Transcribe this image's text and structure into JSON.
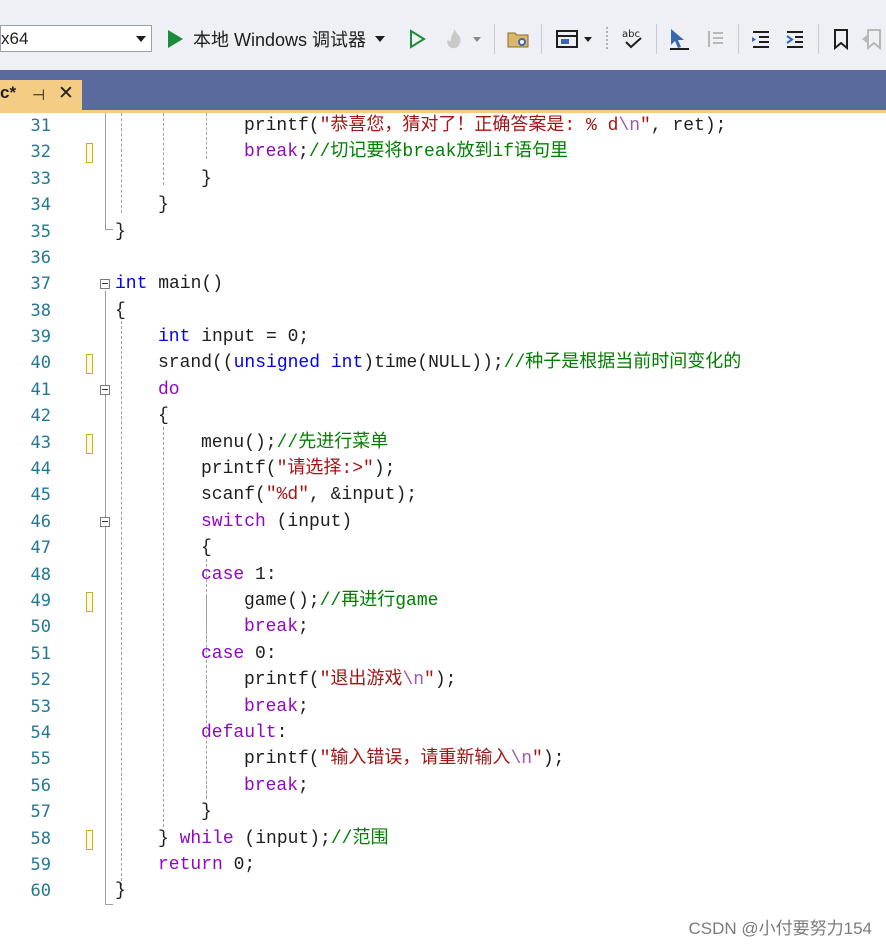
{
  "toolbar": {
    "platform": "x64",
    "debug_target": "本地 Windows 调试器"
  },
  "tab": {
    "title": "c*",
    "pin_glyph": "⊣",
    "close_glyph": "✕"
  },
  "editor": {
    "lines": [
      {
        "n": "31"
      },
      {
        "n": "32"
      },
      {
        "n": "33"
      },
      {
        "n": "34"
      },
      {
        "n": "35"
      },
      {
        "n": "36"
      },
      {
        "n": "37"
      },
      {
        "n": "38"
      },
      {
        "n": "39"
      },
      {
        "n": "40"
      },
      {
        "n": "41"
      },
      {
        "n": "42"
      },
      {
        "n": "43"
      },
      {
        "n": "44"
      },
      {
        "n": "45"
      },
      {
        "n": "46"
      },
      {
        "n": "47"
      },
      {
        "n": "48"
      },
      {
        "n": "49"
      },
      {
        "n": "50"
      },
      {
        "n": "51"
      },
      {
        "n": "52"
      },
      {
        "n": "53"
      },
      {
        "n": "54"
      },
      {
        "n": "55"
      },
      {
        "n": "56"
      },
      {
        "n": "57"
      },
      {
        "n": "58"
      },
      {
        "n": "59"
      },
      {
        "n": "60"
      }
    ],
    "code": {
      "l31": [
        "printf(",
        "\"恭喜您，猜对了！正确答案是: % d",
        "\\n",
        "\"",
        ", ret);"
      ],
      "l32": [
        "break",
        ";",
        "//切记要将break放到if语句里"
      ],
      "l33": [
        "}"
      ],
      "l34": [
        "}"
      ],
      "l35": [
        "}"
      ],
      "l37": [
        "int",
        " main()"
      ],
      "l38": [
        "{"
      ],
      "l39": [
        "int",
        " input = 0;"
      ],
      "l40": [
        "srand((",
        "unsigned",
        " ",
        "int",
        ")time(NULL));",
        "//种子是根据当前时间变化的"
      ],
      "l41": [
        "do"
      ],
      "l42": [
        "{"
      ],
      "l43": [
        "menu();",
        "//先进行菜单"
      ],
      "l44": [
        "printf(",
        "\"请选择:>\"",
        ");"
      ],
      "l45": [
        "scanf(",
        "\"%d\"",
        ", &input);"
      ],
      "l46": [
        "switch",
        " (input)"
      ],
      "l47": [
        "{"
      ],
      "l48": [
        "case",
        " 1:"
      ],
      "l49": [
        "game();",
        "//再进行game"
      ],
      "l50": [
        "break",
        ";"
      ],
      "l51": [
        "case",
        " 0:"
      ],
      "l52": [
        "printf(",
        "\"退出游戏",
        "\\n",
        "\"",
        ");"
      ],
      "l53": [
        "break",
        ";"
      ],
      "l54": [
        "default",
        ":"
      ],
      "l55": [
        "printf(",
        "\"输入错误，请重新输入",
        "\\n",
        "\"",
        ");"
      ],
      "l56": [
        "break",
        ";"
      ],
      "l57": [
        "}"
      ],
      "l58": [
        "} ",
        "while",
        " (input);",
        "//范围"
      ],
      "l59": [
        "return",
        " 0;"
      ],
      "l60": [
        "}"
      ]
    }
  },
  "watermark": "CSDN @小付要努力154"
}
